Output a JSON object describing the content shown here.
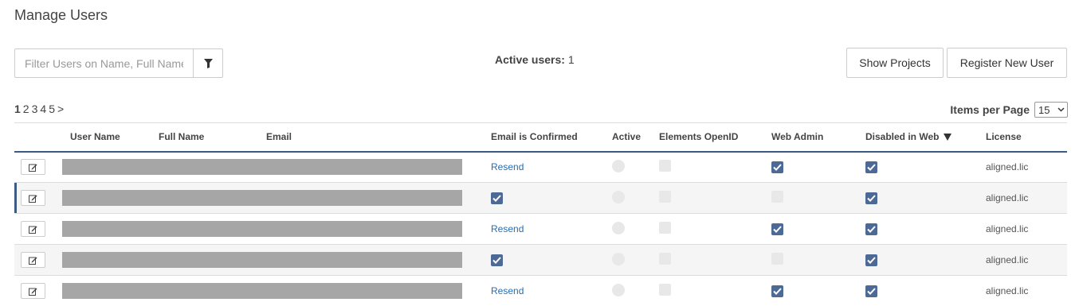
{
  "page": {
    "title": "Manage Users"
  },
  "filter": {
    "placeholder": "Filter Users on Name, Full Name, Email",
    "value": ""
  },
  "active_users": {
    "label": "Active users:",
    "count": "1"
  },
  "buttons": {
    "show_projects": "Show Projects",
    "register": "Register New User"
  },
  "pager": {
    "pages": [
      "1",
      "2",
      "3",
      "4",
      "5"
    ],
    "current": "1",
    "next": ">"
  },
  "items_per_page": {
    "label": "Items per Page",
    "value": "15"
  },
  "table": {
    "columns": {
      "username": "User Name",
      "fullname": "Full Name",
      "email": "Email",
      "email_confirmed": "Email is Confirmed",
      "active": "Active",
      "openid": "Elements OpenID",
      "web_admin": "Web Admin",
      "disabled_web": "Disabled in Web",
      "license": "License"
    },
    "rows": [
      {
        "email_confirmed": "Resend",
        "active": false,
        "openid": false,
        "web_admin": true,
        "disabled_web": true,
        "license": "aligned.lic"
      },
      {
        "email_confirmed": "checked",
        "active": false,
        "openid": false,
        "web_admin": false,
        "disabled_web": true,
        "license": "aligned.lic"
      },
      {
        "email_confirmed": "Resend",
        "active": false,
        "openid": false,
        "web_admin": true,
        "disabled_web": true,
        "license": "aligned.lic"
      },
      {
        "email_confirmed": "checked",
        "active": false,
        "openid": false,
        "web_admin": false,
        "disabled_web": true,
        "license": "aligned.lic"
      },
      {
        "email_confirmed": "Resend",
        "active": false,
        "openid": false,
        "web_admin": true,
        "disabled_web": true,
        "license": "aligned.lic"
      }
    ]
  },
  "colors": {
    "accent": "#3d5a80",
    "checkbox": "#4d6a96",
    "link": "#2a6bb0",
    "redacted": "#a6a6a6"
  },
  "icons": {
    "filter": "filter-icon",
    "edit": "edit-icon",
    "sort": "sort-desc-icon",
    "select": "chevron-down-icon"
  }
}
